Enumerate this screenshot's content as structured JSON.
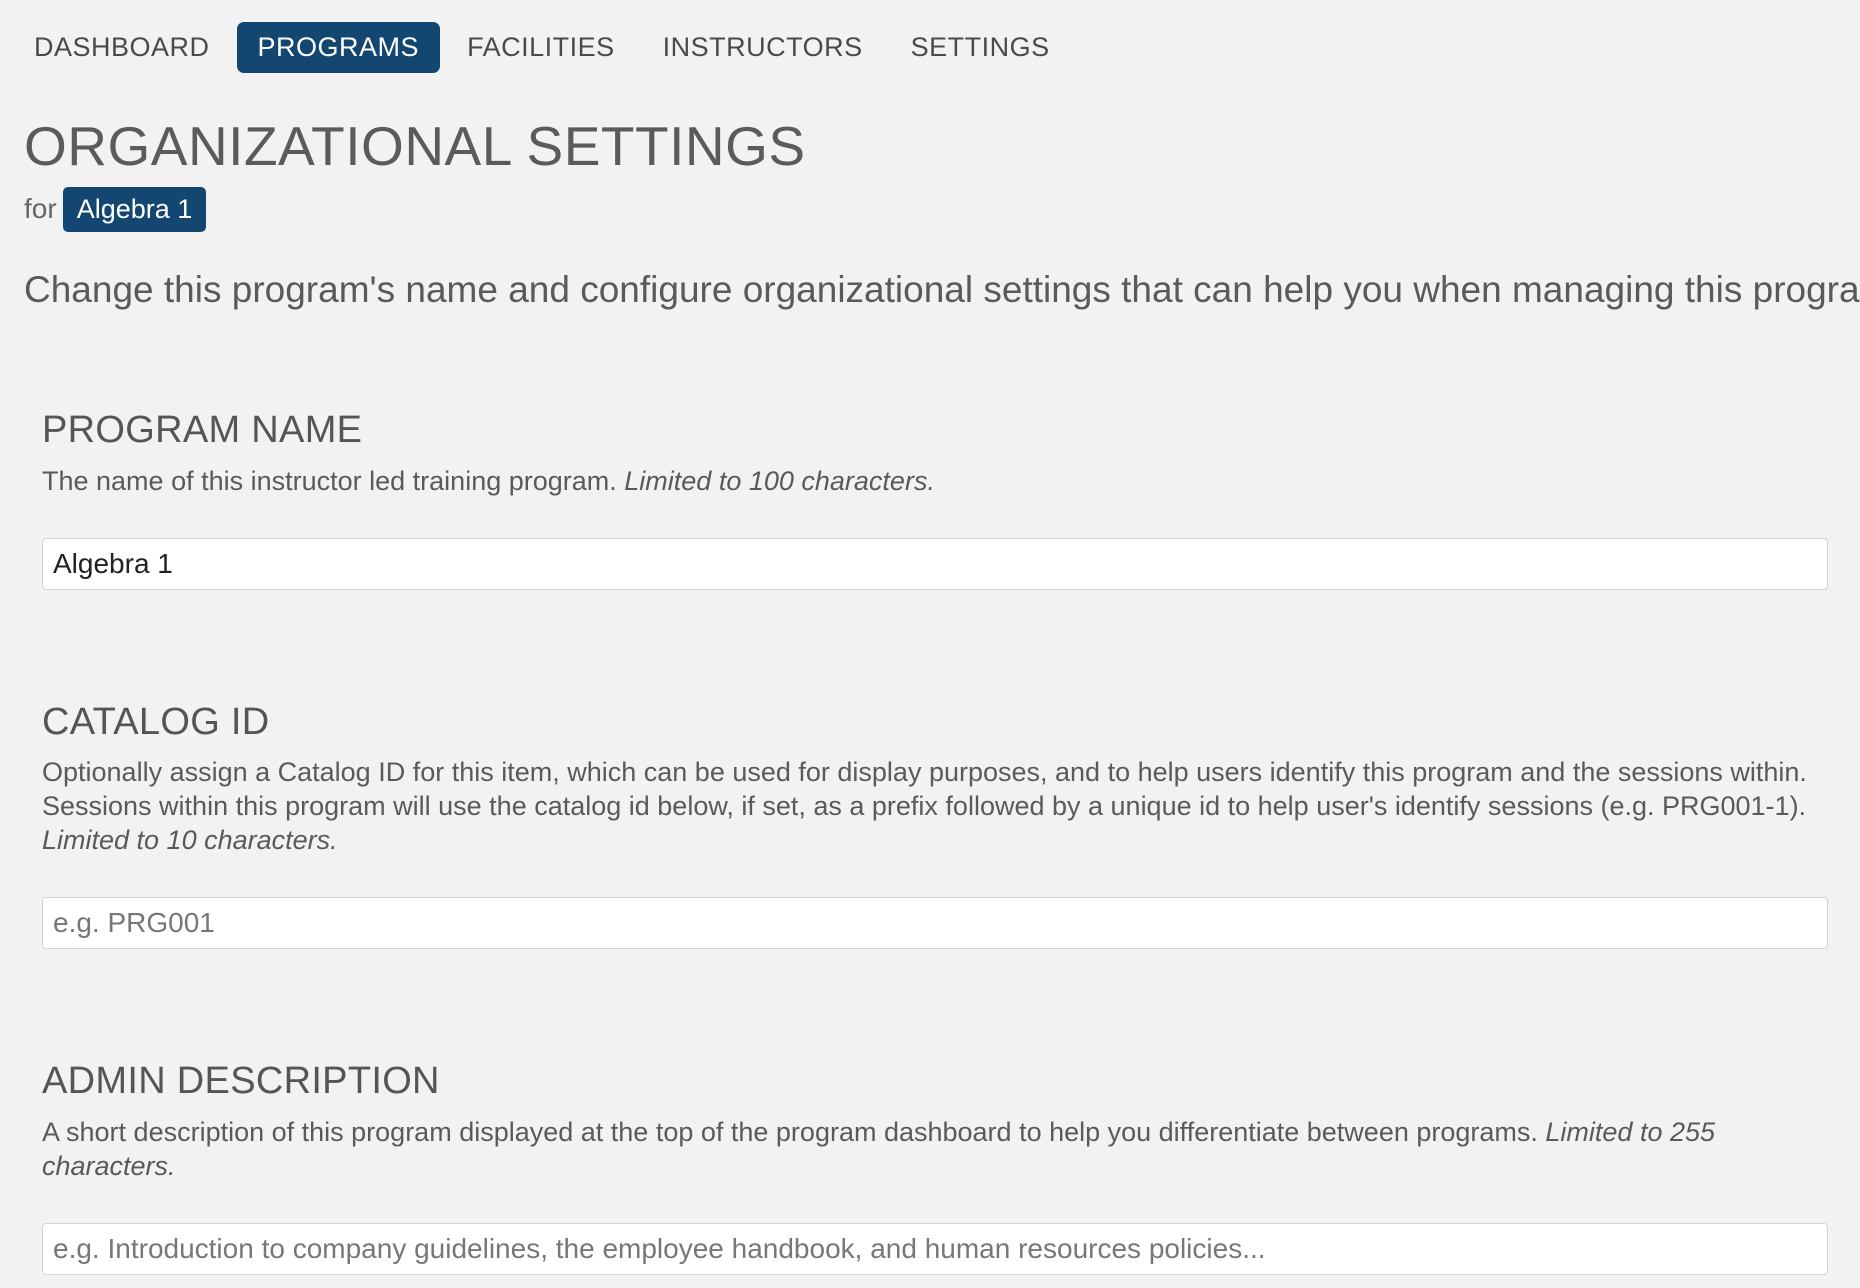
{
  "nav": {
    "items": [
      {
        "label": "DASHBOARD",
        "active": false
      },
      {
        "label": "PROGRAMS",
        "active": true
      },
      {
        "label": "FACILITIES",
        "active": false
      },
      {
        "label": "INSTRUCTORS",
        "active": false
      },
      {
        "label": "SETTINGS",
        "active": false
      }
    ]
  },
  "header": {
    "title": "ORGANIZATIONAL SETTINGS",
    "for_label": "for",
    "program_badge": "Algebra 1",
    "intro": "Change this program's name and configure organizational settings that can help you when managing this program."
  },
  "sections": {
    "program_name": {
      "heading": "PROGRAM NAME",
      "description": "The name of this instructor led training program.",
      "limit": "Limited to 100 characters.",
      "value": "Algebra 1",
      "placeholder": ""
    },
    "catalog_id": {
      "heading": "CATALOG ID",
      "description": "Optionally assign a Catalog ID for this item, which can be used for display purposes, and to help users identify this program and the sessions within. Sessions within this program will use the catalog id below, if set, as a prefix followed by a unique id to help user's identify sessions (e.g. PRG001-1).",
      "limit": "Limited to 10 characters.",
      "value": "",
      "placeholder": "e.g. PRG001"
    },
    "admin_description": {
      "heading": "ADMIN DESCRIPTION",
      "description": "A short description of this program displayed at the top of the program dashboard to help you differentiate between programs.",
      "limit": "Limited to 255 characters.",
      "value": "",
      "placeholder": "e.g. Introduction to company guidelines, the employee handbook, and human resources policies..."
    }
  },
  "colors": {
    "accent": "#134670",
    "background": "#f2f2f2"
  }
}
